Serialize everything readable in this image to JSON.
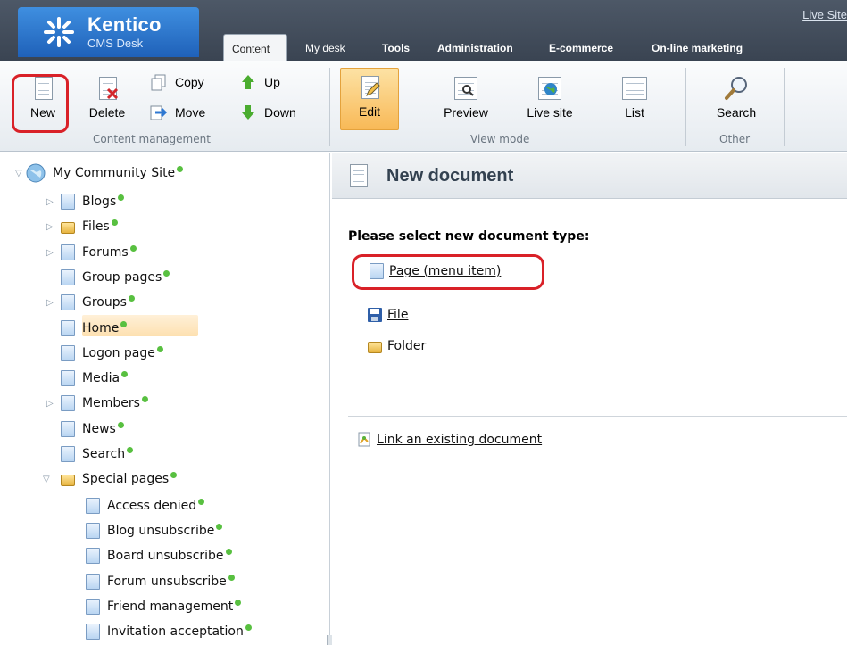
{
  "header": {
    "brand": "Kentico",
    "product": "CMS Desk",
    "live_site_link": "Live Site",
    "tabs": [
      {
        "label": "Content",
        "active": true
      },
      {
        "label": "My desk"
      },
      {
        "label": "Tools"
      },
      {
        "label": "Administration"
      },
      {
        "label": "E-commerce"
      },
      {
        "label": "On-line marketing"
      }
    ]
  },
  "toolbar": {
    "content_management": {
      "group_label": "Content management",
      "new": "New",
      "delete": "Delete",
      "copy": "Copy",
      "move": "Move",
      "up": "Up",
      "down": "Down"
    },
    "view_mode": {
      "group_label": "View mode",
      "edit": "Edit",
      "preview": "Preview",
      "live_site": "Live site",
      "list": "List"
    },
    "other": {
      "group_label": "Other",
      "search": "Search"
    }
  },
  "tree": {
    "root": "My Community Site",
    "items": [
      {
        "label": "Blogs"
      },
      {
        "label": "Files"
      },
      {
        "label": "Forums"
      },
      {
        "label": "Group pages"
      },
      {
        "label": "Groups"
      },
      {
        "label": "Home"
      },
      {
        "label": "Logon page"
      },
      {
        "label": "Media"
      },
      {
        "label": "Members"
      },
      {
        "label": "News"
      },
      {
        "label": "Search"
      },
      {
        "label": "Special pages"
      }
    ],
    "special_children": [
      {
        "label": "Access denied"
      },
      {
        "label": "Blog unsubscribe"
      },
      {
        "label": "Board unsubscribe"
      },
      {
        "label": "Forum unsubscribe"
      },
      {
        "label": "Friend management"
      },
      {
        "label": "Invitation acceptation"
      }
    ]
  },
  "panel": {
    "title": "New document",
    "prompt": "Please select new document type:",
    "types": [
      {
        "label": "Page (menu item)"
      },
      {
        "label": "File"
      },
      {
        "label": "Folder"
      }
    ],
    "link_existing": "Link an existing document"
  },
  "colors": {
    "header_bg": "#3f4957",
    "brand_blue": "#2f78d2",
    "highlight_ring": "#d92128",
    "published_dot": "#58c040",
    "edit_active": "#f8b957"
  }
}
